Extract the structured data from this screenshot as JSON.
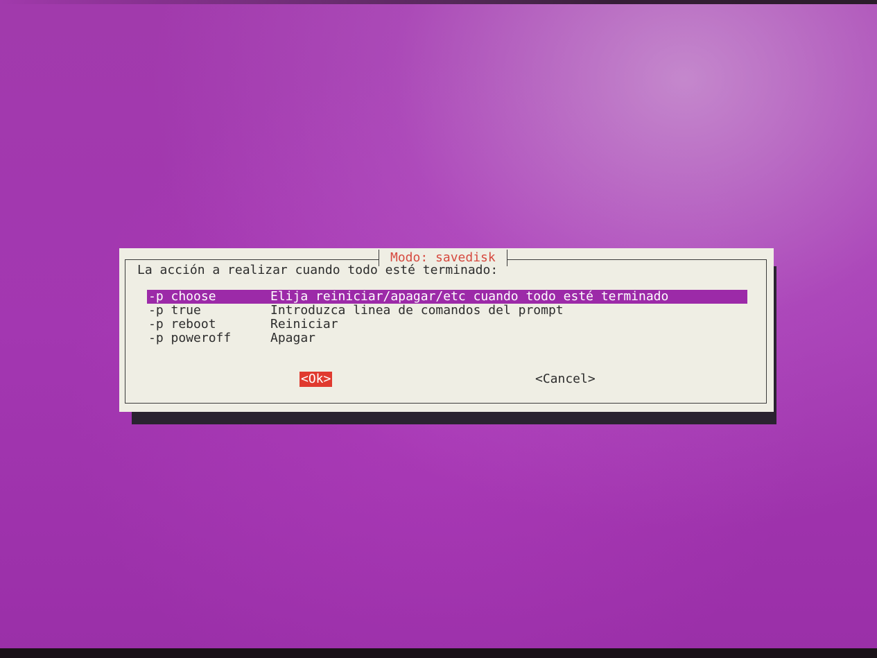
{
  "dialog": {
    "title": "Modo: savedisk",
    "prompt": "La acción a realizar cuando todo esté terminado:",
    "items": [
      {
        "tag": "-p choose",
        "desc": "Elija reiniciar/apagar/etc cuando todo esté terminado",
        "selected": true
      },
      {
        "tag": "-p true",
        "desc": "Introduzca linea de comandos del prompt",
        "selected": false
      },
      {
        "tag": "-p reboot",
        "desc": "Reiniciar",
        "selected": false
      },
      {
        "tag": "-p poweroff",
        "desc": "Apagar",
        "selected": false
      }
    ],
    "ok_label": "<Ok>",
    "cancel_label": "<Cancel>"
  },
  "colors": {
    "background": "#9b2ea6",
    "dialog_bg": "#efeee4",
    "title": "#d6493f",
    "selection": "#9c2aa8",
    "ok_button": "#e03a2f"
  }
}
